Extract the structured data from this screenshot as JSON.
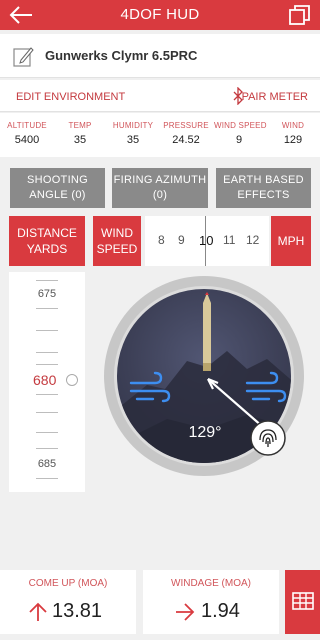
{
  "header": {
    "title": "4DOF HUD",
    "back_icon": "back-arrow-icon",
    "copy_icon": "copy-icon"
  },
  "profile": {
    "name": "Gunwerks Clymr 6.5PRC",
    "edit_icon": "edit-pencil-icon"
  },
  "environment_bar": {
    "edit_label": "EDIT ENVIRONMENT",
    "pair_label": "PAIR METER",
    "bluetooth_icon": "bluetooth-icon"
  },
  "environment": [
    {
      "label": "ALTITUDE",
      "value": "5400"
    },
    {
      "label": "TEMP",
      "value": "35"
    },
    {
      "label": "HUMIDITY",
      "value": "35"
    },
    {
      "label": "PRESSURE",
      "value": "24.52"
    },
    {
      "label": "WIND SPEED",
      "value": "9"
    },
    {
      "label": "WIND",
      "value": "129"
    }
  ],
  "actions": {
    "shooting_angle": "SHOOTING\nANGLE (0)",
    "firing_azimuth": "FIRING AZIMUTH\n(0)",
    "earth_effects": "EARTH BASED\nEFFECTS"
  },
  "distance": {
    "label": "DISTANCE\nYARDS",
    "values": [
      "675",
      "680",
      "685"
    ],
    "selected": "680"
  },
  "wind_speed": {
    "label": "WIND\nSPEED",
    "options": [
      "8",
      "9",
      "10",
      "11",
      "12"
    ],
    "selected": "10",
    "unit": "MPH"
  },
  "dial": {
    "angle": "129°",
    "wind_icon": "wind-icon",
    "fingerprint_icon": "fingerprint-icon"
  },
  "results": {
    "come_up_label": "COME UP (MOA)",
    "come_up_value": "13.81",
    "windage_label": "WINDAGE (MOA)",
    "windage_value": "1.94",
    "table_icon": "table-icon"
  },
  "colors": {
    "accent": "#d93a3f",
    "grey": "#8a8a8a",
    "dial": "#3d4057"
  }
}
